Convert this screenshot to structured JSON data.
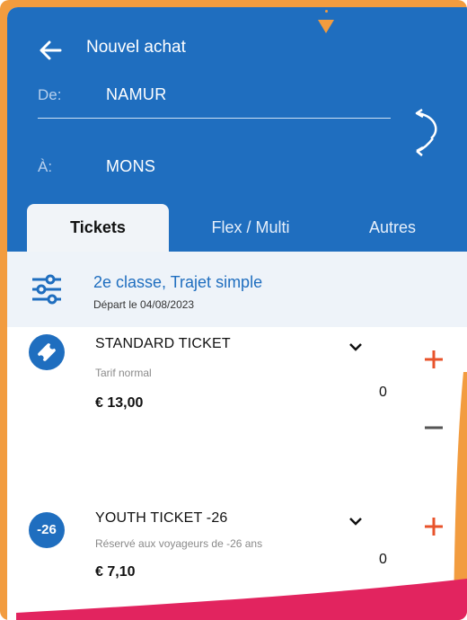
{
  "header": {
    "title": "Nouvel achat",
    "from_label": "De:",
    "from_value": "NAMUR",
    "to_label": "À:",
    "to_value": "MONS"
  },
  "tabs": [
    {
      "label": "Tickets",
      "active": true
    },
    {
      "label": "Flex / Multi",
      "active": false
    },
    {
      "label": "Autres",
      "active": false
    }
  ],
  "options": {
    "title": "2e classe, Trajet simple",
    "subtitle": "Départ le 04/08/2023"
  },
  "tickets": [
    {
      "icon": "ticket-icon",
      "name": "STANDARD TICKET",
      "description": "Tarif normal",
      "price": "€ 13,00",
      "quantity": "0"
    },
    {
      "icon_text": "-26",
      "name": "YOUTH TICKET -26",
      "description": "Réservé aux voyageurs de -26 ans",
      "price": "€ 7,10",
      "quantity": "0"
    }
  ],
  "colors": {
    "brand_blue": "#1f6ebf",
    "accent_orange": "#f29c3f",
    "action_red": "#e8532b",
    "magenta": "#e2245f"
  }
}
